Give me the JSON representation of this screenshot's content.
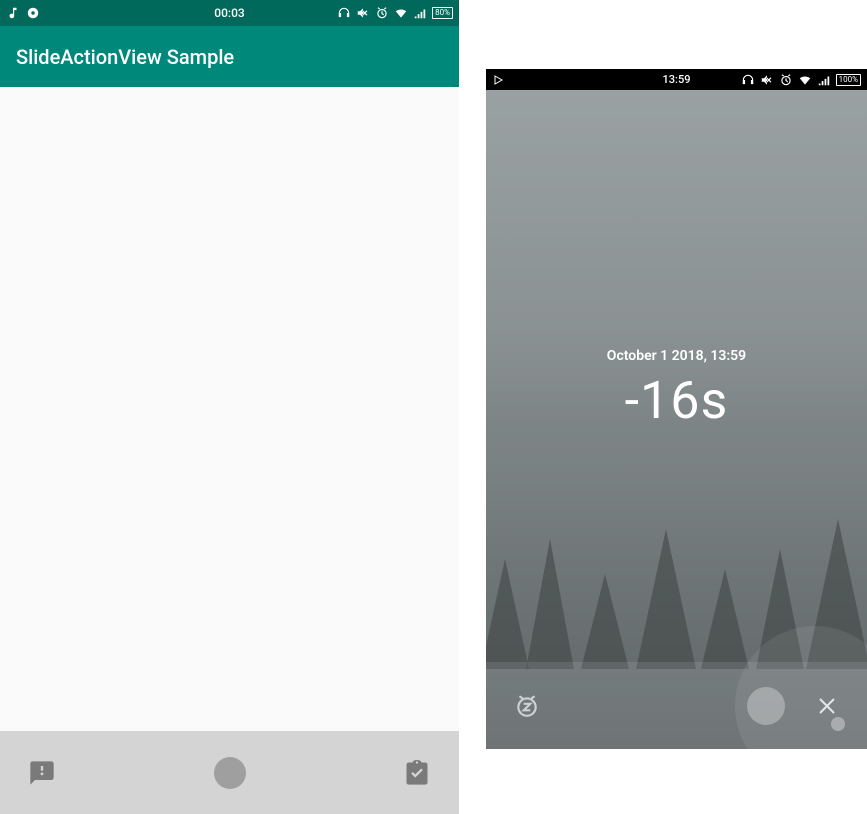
{
  "left": {
    "statusbar": {
      "time": "00:03",
      "battery_text": "80%"
    },
    "appbar_title": "SlideActionView Sample",
    "slide": {
      "left_icon": "exclamation-bubble-icon",
      "right_icon": "clipboard-check-icon"
    }
  },
  "right": {
    "statusbar": {
      "time": "13:59",
      "battery_text": "100%"
    },
    "date_text": "October 1 2018, 13:59",
    "countdown": "-16s",
    "slide": {
      "left_icon": "snooze-icon",
      "right_icon": "close-icon"
    }
  }
}
